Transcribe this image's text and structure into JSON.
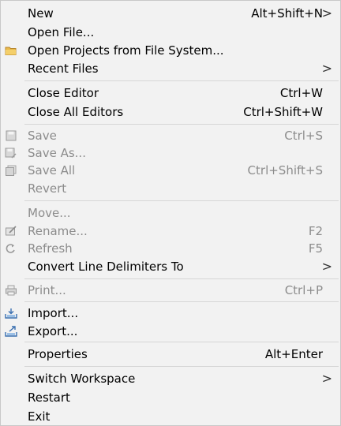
{
  "menu": {
    "items": [
      {
        "label": "New",
        "shortcut": "Alt+Shift+N",
        "submenu": ">"
      },
      {
        "label": "Open File...",
        "shortcut": ""
      },
      {
        "label": "Open Projects from File System...",
        "shortcut": "",
        "icon": "folder-icon"
      },
      {
        "label": "Recent Files",
        "shortcut": "",
        "submenu": ">"
      },
      {
        "label": "Close Editor",
        "shortcut": "Ctrl+W"
      },
      {
        "label": "Close All Editors",
        "shortcut": "Ctrl+Shift+W"
      },
      {
        "label": "Save",
        "shortcut": "Ctrl+S",
        "disabled": true,
        "icon": "save-icon"
      },
      {
        "label": "Save As...",
        "shortcut": "",
        "disabled": true,
        "icon": "save-as-icon"
      },
      {
        "label": "Save All",
        "shortcut": "Ctrl+Shift+S",
        "disabled": true,
        "icon": "save-all-icon"
      },
      {
        "label": "Revert",
        "shortcut": "",
        "disabled": true
      },
      {
        "label": "Move...",
        "shortcut": "",
        "disabled": true
      },
      {
        "label": "Rename...",
        "shortcut": "F2",
        "disabled": true,
        "icon": "rename-icon"
      },
      {
        "label": "Refresh",
        "shortcut": "F5",
        "disabled": true,
        "icon": "refresh-icon"
      },
      {
        "label": "Convert Line Delimiters To",
        "shortcut": "",
        "submenu": ">"
      },
      {
        "label": "Print...",
        "shortcut": "Ctrl+P",
        "disabled": true,
        "icon": "print-icon"
      },
      {
        "label": "Import...",
        "shortcut": "",
        "icon": "import-icon"
      },
      {
        "label": "Export...",
        "shortcut": "",
        "icon": "export-icon"
      },
      {
        "label": "Properties",
        "shortcut": "Alt+Enter"
      },
      {
        "label": "Switch Workspace",
        "shortcut": "",
        "submenu": ">"
      },
      {
        "label": "Restart",
        "shortcut": ""
      },
      {
        "label": "Exit",
        "shortcut": ""
      }
    ],
    "colors": {
      "background": "#f2f2f2",
      "text": "#000000",
      "disabled_text": "#8c8c8c",
      "separator": "#d6d6d6",
      "folder_icon": "#e8b84a",
      "import_export_icon": "#3a6fb0"
    }
  }
}
